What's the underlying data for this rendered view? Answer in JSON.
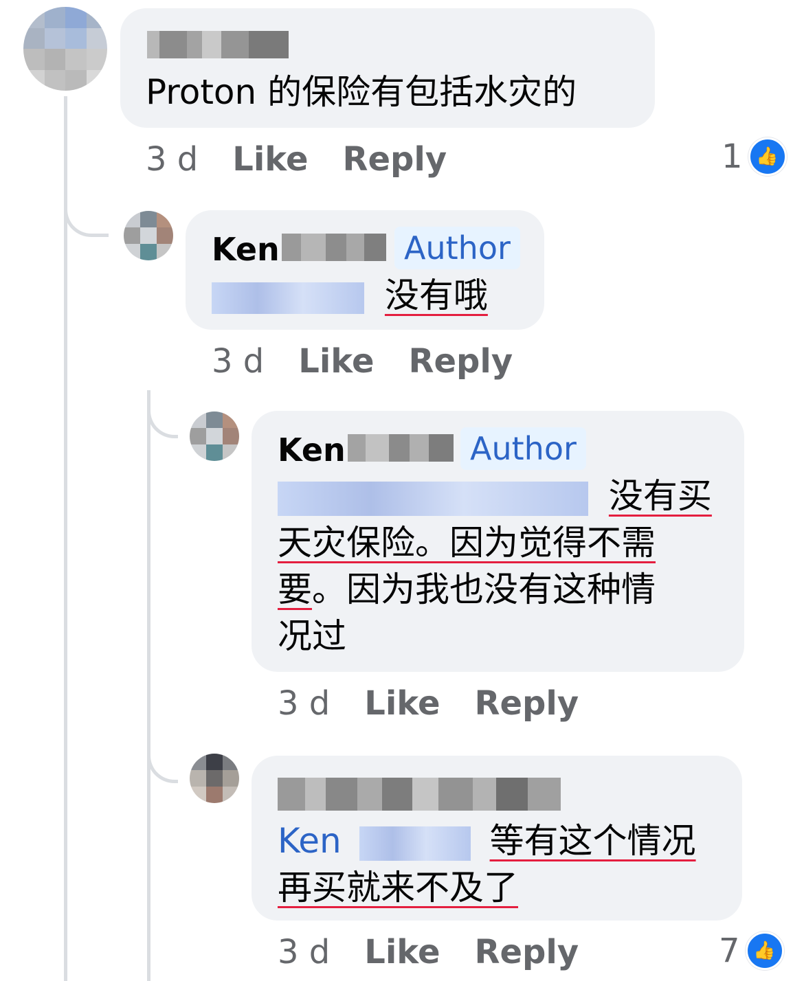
{
  "comments": [
    {
      "text": "Proton 的保险有包括水灾的",
      "time": "3 d",
      "like_label": "Like",
      "reply_label": "Reply",
      "reactions": "1"
    },
    {
      "name": "Ken",
      "badge": "Author",
      "text": "没有哦",
      "time": "3 d",
      "like_label": "Like",
      "reply_label": "Reply"
    },
    {
      "name": "Ken",
      "badge": "Author",
      "text_line1": "没有买",
      "text_line2": "天灾保险。因为觉得不需",
      "text_line3a": "要",
      "text_line3b": "。因为我也没有这种情",
      "text_line4": "况过",
      "time": "3 d",
      "like_label": "Like",
      "reply_label": "Reply"
    },
    {
      "mention": "Ken",
      "text_line1": "等有这个情况",
      "text_line2": "再买就来不及了",
      "time": "3 d",
      "like_label": "Like",
      "reply_label": "Reply",
      "reactions": "7"
    }
  ],
  "colors": {
    "bubble": "#f0f2f5",
    "link": "#2c64c6",
    "meta": "#65676b",
    "like_blue": "#1877f2",
    "spellcheck_underline": "#e41e3f"
  },
  "icons": [
    "thumbs-up-icon"
  ]
}
